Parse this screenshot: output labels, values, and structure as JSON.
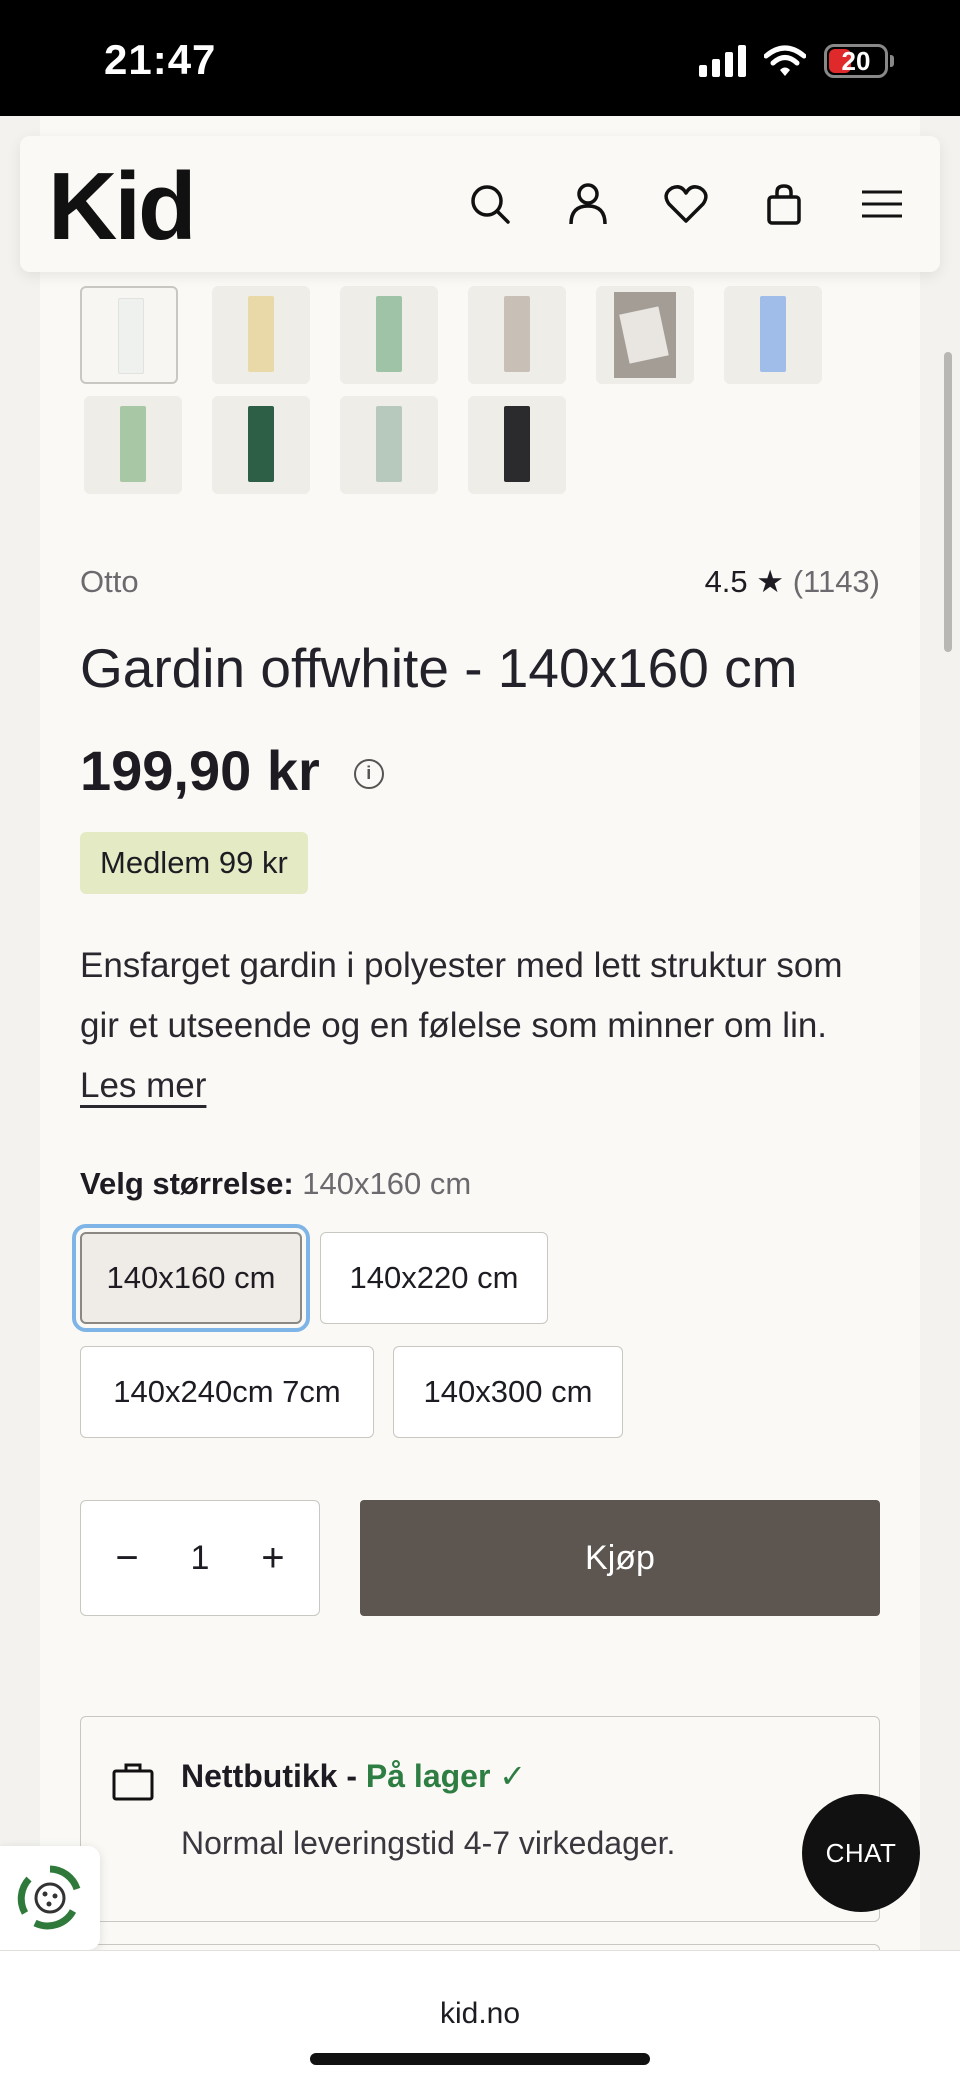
{
  "status_bar": {
    "time": "21:47",
    "battery": "20"
  },
  "header": {
    "logo": "Kid",
    "icons": [
      "search-icon",
      "user-icon",
      "heart-icon",
      "bag-icon",
      "menu-icon"
    ]
  },
  "gallery": {
    "thumbnails": [
      {
        "color": "#eef1ee"
      },
      {
        "color": "#ead9a8"
      },
      {
        "color": "#9fc3a6"
      },
      {
        "color": "#c8c0b6"
      },
      {
        "color": "photo"
      },
      {
        "color": "#9fbde8"
      },
      {
        "color": "#a8c8a5"
      },
      {
        "color": "#2d5e46"
      },
      {
        "color": "#b7c8bc"
      },
      {
        "color": "#2b2a2c"
      }
    ]
  },
  "product": {
    "brand": "Otto",
    "rating": {
      "value": "4.5 ★",
      "count": "(1143)"
    },
    "title": "Gardin offwhite - 140x160 cm",
    "price": "199,90 kr",
    "member_price": "Medlem 99 kr",
    "description": "Ensfarget gardin i polyester med lett struktur som gir et utseende og en følelse som minner om lin.",
    "read_more": "Les mer"
  },
  "size": {
    "label": "Velg størrelse:",
    "selected": "140x160 cm",
    "options": [
      "140x160 cm",
      "140x220 cm",
      "140x240cm 7cm",
      "140x300 cm"
    ]
  },
  "purchase": {
    "quantity": "1",
    "minus": "−",
    "plus": "+",
    "buy_label": "Kjøp"
  },
  "stock": {
    "title": "Nettbutikk -",
    "status": "På lager ✓",
    "delivery": "Normal leveringstid 4-7 virkedager."
  },
  "chat": {
    "label": "CHAT"
  },
  "browser": {
    "url": "kid.no"
  }
}
